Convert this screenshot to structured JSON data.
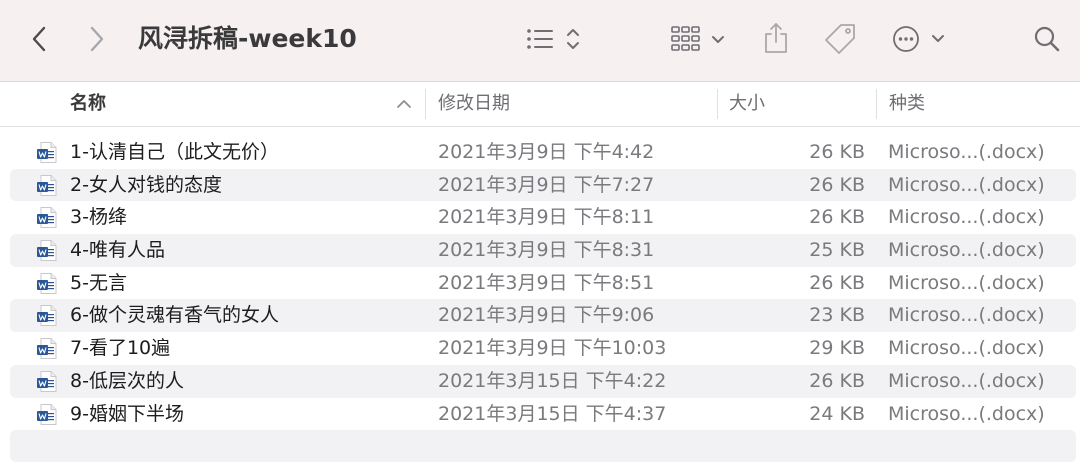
{
  "window": {
    "title": "风浔拆稿-week10"
  },
  "toolbar": {
    "back_icon": "chevron-left-icon",
    "forward_icon": "chevron-right-icon",
    "list_view_icon": "list-view-icon",
    "grid_view_icon": "grid-view-icon",
    "share_icon": "share-icon",
    "tag_icon": "tag-icon",
    "more_icon": "ellipsis-circle-icon",
    "search_icon": "search-icon"
  },
  "columns": {
    "name": "名称",
    "date": "修改日期",
    "size": "大小",
    "kind": "种类"
  },
  "files": [
    {
      "name": "1-认清自己（此文无价）",
      "date": "2021年3月9日 下午4:42",
      "size": "26 KB",
      "kind": "Microso...(.docx)"
    },
    {
      "name": "2-女人对钱的态度",
      "date": "2021年3月9日 下午7:27",
      "size": "26 KB",
      "kind": "Microso...(.docx)"
    },
    {
      "name": "3-杨绛",
      "date": "2021年3月9日 下午8:11",
      "size": "26 KB",
      "kind": "Microso...(.docx)"
    },
    {
      "name": "4-唯有人品",
      "date": "2021年3月9日 下午8:31",
      "size": "25 KB",
      "kind": "Microso...(.docx)"
    },
    {
      "name": "5-无言",
      "date": "2021年3月9日 下午8:51",
      "size": "26 KB",
      "kind": "Microso...(.docx)"
    },
    {
      "name": "6-做个灵魂有香气的女人",
      "date": "2021年3月9日 下午9:06",
      "size": "23 KB",
      "kind": "Microso...(.docx)"
    },
    {
      "name": "7-看了10遍",
      "date": "2021年3月9日 下午10:03",
      "size": "29 KB",
      "kind": "Microso...(.docx)"
    },
    {
      "name": "8-低层次的人",
      "date": "2021年3月15日 下午4:22",
      "size": "26 KB",
      "kind": "Microso...(.docx)"
    },
    {
      "name": "9-婚姻下半场",
      "date": "2021年3月15日 下午4:37",
      "size": "24 KB",
      "kind": "Microso...(.docx)"
    }
  ],
  "colors": {
    "toolbar_bg": "#f7f0f0",
    "alt_row": "#f2f2f4",
    "word_blue": "#2b5797"
  }
}
